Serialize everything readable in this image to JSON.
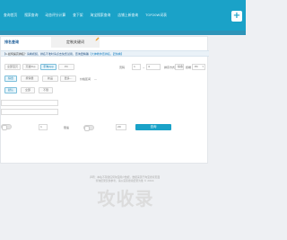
{
  "colors": {
    "brand": "#1aa2c8",
    "tab_active_text": "#1f5f9a",
    "notice_bg": "#eaf2f8"
  },
  "topnav": {
    "items": [
      "查询首页",
      "搜索查询",
      "动态评分计算",
      "查下架",
      "淘宝搜索查询",
      "店铺上新查询",
      "TOP20W词表"
    ],
    "plus_icon": "plus"
  },
  "tabs": {
    "first": "排名查询",
    "custom": "定制关键词",
    "pencil_icon": "pencil-icon"
  },
  "notice": {
    "prefix": "【",
    "bold": "1.如何提高排名？",
    "text": "请看视频，排名不准时请点击免费试用，查询更精确",
    "link": "【大神教你查排名，赶快看】"
  },
  "filters": {
    "row1": [
      "全部宝贝",
      "天猫Top",
      "手淘App",
      "PC"
    ],
    "row2": [
      "综合",
      "按销量",
      "新品",
      "更多..."
    ],
    "row2_label": "价格区间",
    "row2_sep": "—",
    "row3": [
      "默认",
      "全部",
      "不限"
    ],
    "page_label": "页码",
    "page_from": "1",
    "page_sep": "~",
    "page_to": "4",
    "sort_label": "排序方式",
    "sort_value": "综合",
    "device_label": "终端",
    "device_value": "PC"
  },
  "bottom": {
    "count_value": "1",
    "speed_label": "限速",
    "limit_value": "20",
    "search_button": "查询"
  },
  "footer": {
    "line1": "声明：本站不存储任何淘宝用户数据，数据来源于淘宝搜索页面",
    "line2": "查询结果仅供参考，请以实际搜索结果为准 © 2016",
    "watermark": "攻收录"
  }
}
